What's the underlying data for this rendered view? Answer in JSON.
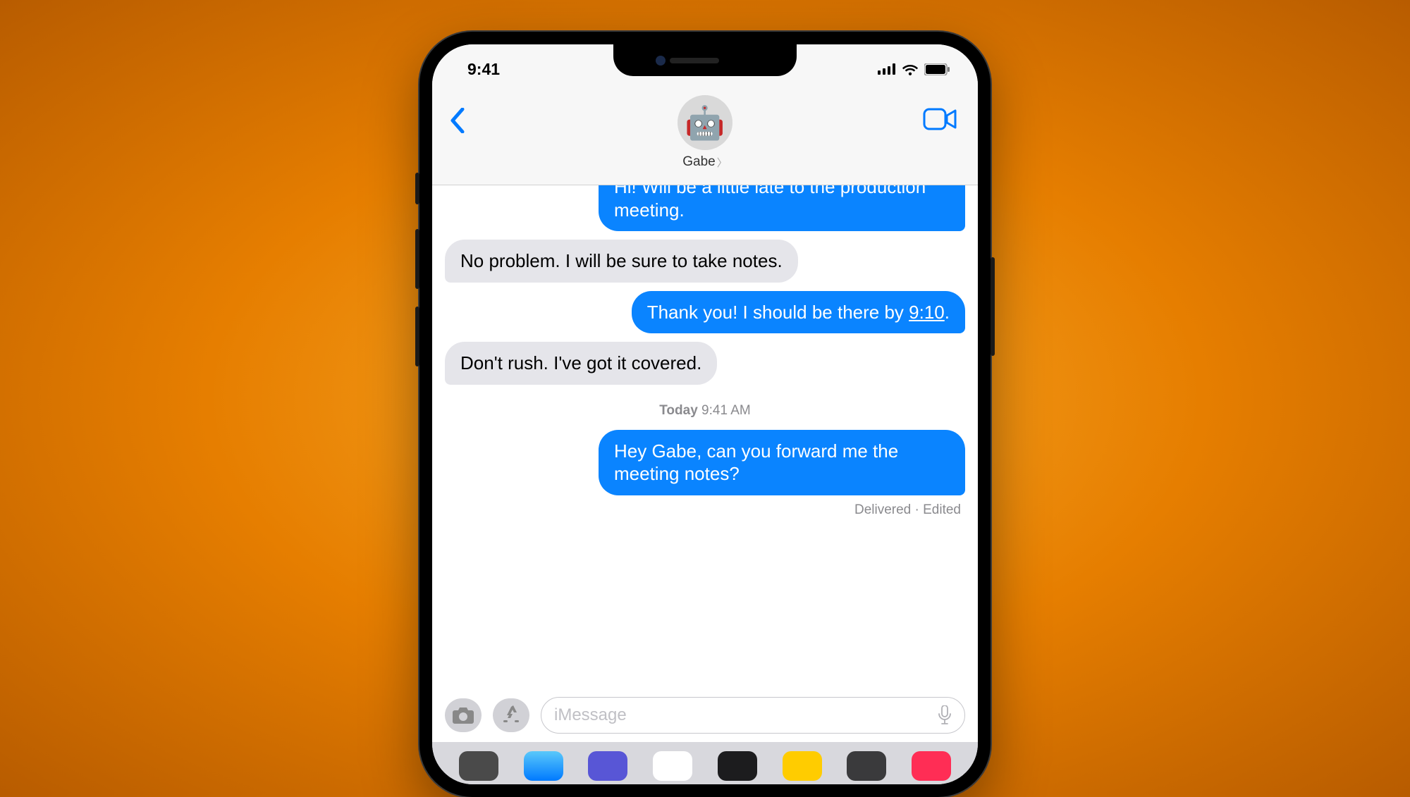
{
  "status": {
    "time": "9:41"
  },
  "header": {
    "contact_name": "Gabe",
    "avatar_emoji": "🤖"
  },
  "messages": [
    {
      "side": "sent",
      "text": "Hi! Will be a little late to the production meeting.",
      "cut_top": true
    },
    {
      "side": "recv",
      "text": "No problem. I will be sure to take notes."
    },
    {
      "side": "sent",
      "text": "Thank you! I should be there by ",
      "time_link": "9:10",
      "suffix": "."
    },
    {
      "side": "recv",
      "text": "Don't rush. I've got it covered."
    }
  ],
  "timestamp": {
    "day": "Today",
    "time": "9:41 AM"
  },
  "last_message": {
    "side": "sent",
    "text": "Hey Gabe, can you forward me the meeting notes?"
  },
  "delivery_status": "Delivered · Edited",
  "input": {
    "placeholder": "iMessage"
  }
}
